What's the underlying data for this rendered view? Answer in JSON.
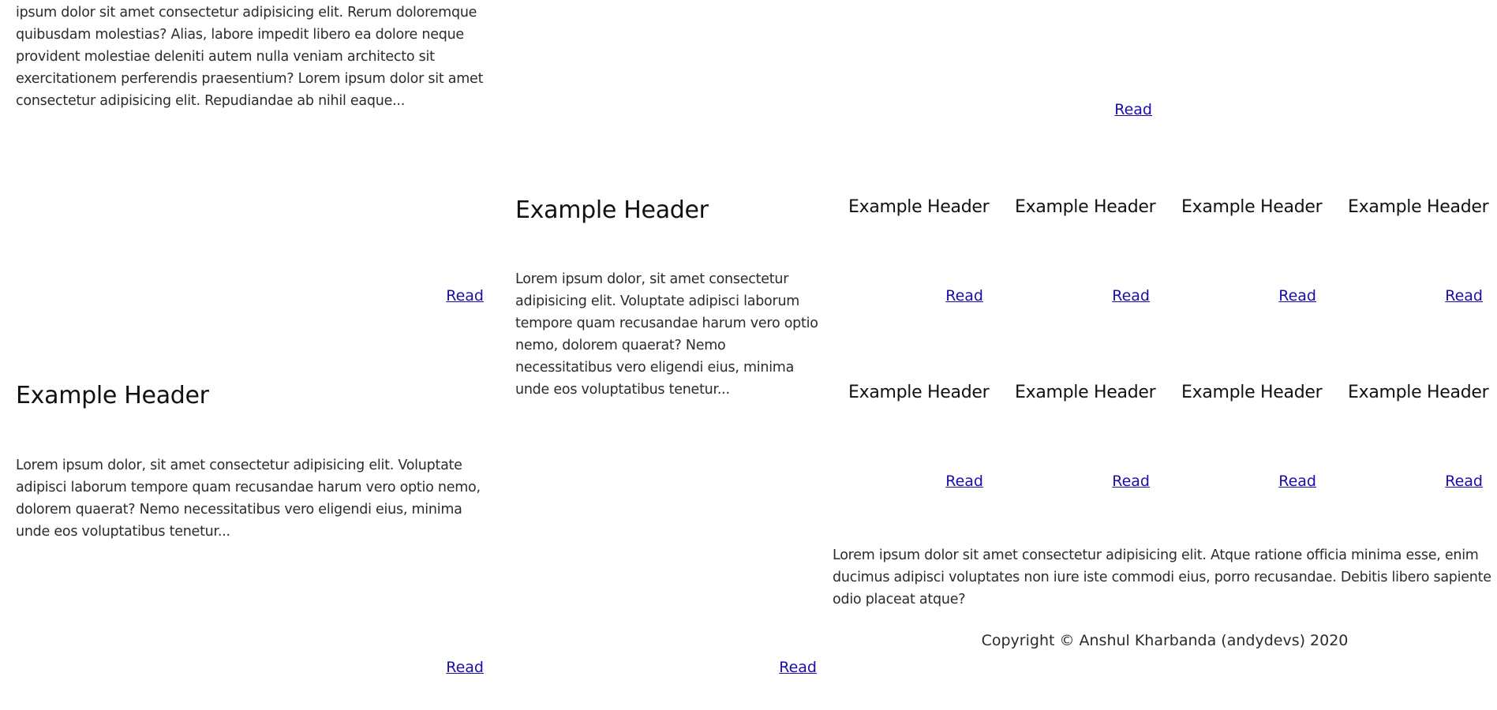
{
  "cards": {
    "top_left": {
      "text": "ipsum dolor sit amet consectetur adipisicing elit. Rerum doloremque quibusdam molestias? Alias, labore impedit libero ea dolore neque provident molestiae deleniti autem nulla veniam architecto sit exercitationem perferendis praesentium? Lorem ipsum dolor sit amet consectetur adipisicing elit. Repudiandae ab nihil eaque...",
      "link": "Read"
    },
    "top_wide": {
      "link": "Read"
    },
    "left_mid": {
      "link": "Read"
    },
    "left_bottom": {
      "title": "Example Header",
      "text": "Lorem ipsum dolor, sit amet consectetur adipisicing elit. Voluptate adipisci laborum tempore quam recusandae harum vero optio nemo, dolorem quaerat? Nemo necessitatibus vero eligendi eius, minima unde eos voluptatibus tenetur...",
      "link": "Read"
    },
    "center": {
      "title": "Example Header",
      "text": "Lorem ipsum dolor, sit amet consectetur adipisicing elit. Voluptate adipisci laborum tempore quam recusandae harum vero optio nemo, dolorem quaerat? Nemo necessitatibus vero eligendi eius, minima unde eos voluptatibus tenetur...",
      "link": "Read"
    },
    "small_grid": [
      {
        "title": "Example Header",
        "link": "Read"
      },
      {
        "title": "Example Header",
        "link": "Read"
      },
      {
        "title": "Example Header",
        "link": "Read"
      },
      {
        "title": "Example Header",
        "link": "Read"
      },
      {
        "title": "Example Header",
        "link": "Read"
      },
      {
        "title": "Example Header",
        "link": "Read"
      },
      {
        "title": "Example Header",
        "link": "Read"
      },
      {
        "title": "Example Header",
        "link": "Read"
      }
    ],
    "bottom_right": {
      "text": "Lorem ipsum dolor sit amet consectetur adipisicing elit. Atque ratione officia minima esse, enim ducimus adipisci voluptates non iure iste commodi eius, porro recusandae. Debitis libero sapiente odio placeat atque?"
    }
  },
  "footer": {
    "copyright": "Copyright © Anshul Kharbanda (andydevs) 2020"
  },
  "colors": {
    "link": "#1a0dab",
    "text": "#2b2b2b",
    "heading": "#111111",
    "background": "#ffffff"
  }
}
